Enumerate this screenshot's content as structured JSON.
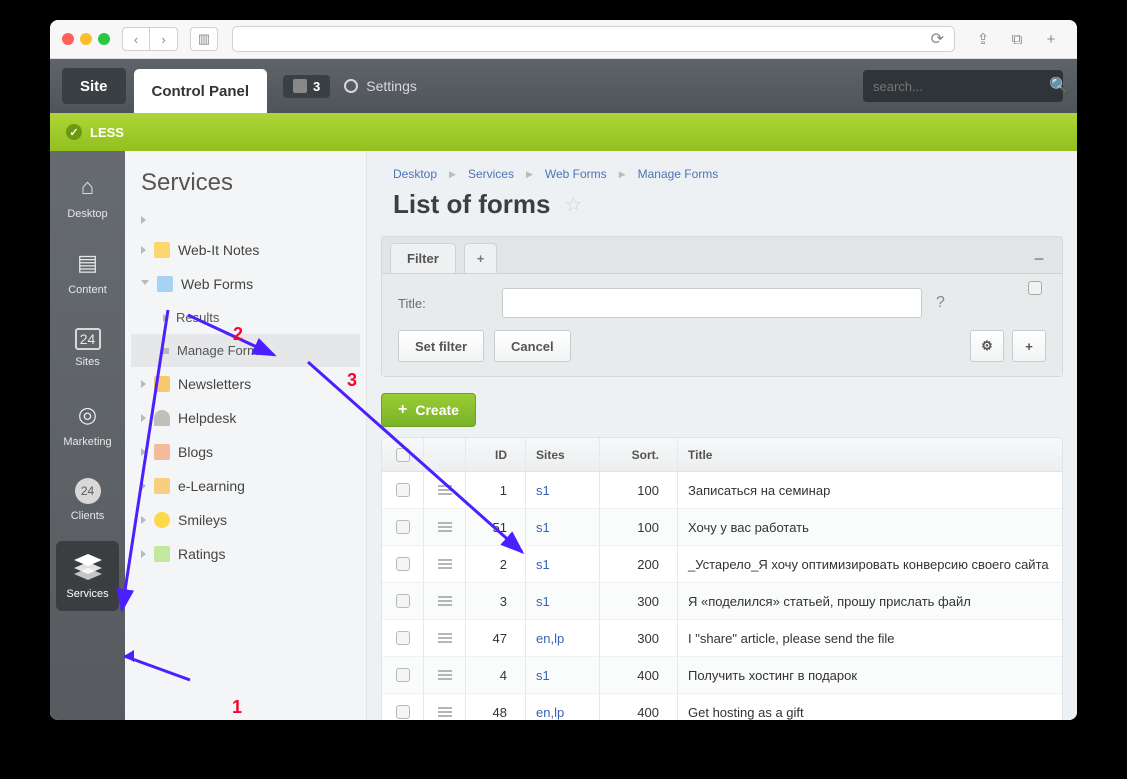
{
  "topbar": {
    "site_label": "Site",
    "cp_label": "Control Panel",
    "badge_count": "3",
    "settings_label": "Settings",
    "search_placeholder": "search..."
  },
  "greenbar": {
    "text": "LESS"
  },
  "rail": [
    {
      "label": "Desktop",
      "icon": "house-icon"
    },
    {
      "label": "Content",
      "icon": "doc-icon"
    },
    {
      "label": "Sites",
      "icon": "calendar-icon"
    },
    {
      "label": "Marketing",
      "icon": "target-icon"
    },
    {
      "label": "Clients",
      "icon": "client-icon"
    },
    {
      "label": "Services",
      "icon": "layers-icon",
      "active": true
    }
  ],
  "tree": {
    "title": "Services",
    "items": [
      {
        "icon": "ic-note",
        "label": "Web-It Notes"
      },
      {
        "icon": "ic-form",
        "label": "Web Forms",
        "open": true,
        "children": [
          {
            "label": "Results"
          },
          {
            "label": "Manage Forms",
            "selected": true
          }
        ]
      },
      {
        "icon": "ic-news",
        "label": "Newsletters"
      },
      {
        "icon": "ic-head",
        "label": "Helpdesk"
      },
      {
        "icon": "ic-blog",
        "label": "Blogs"
      },
      {
        "icon": "ic-learn",
        "label": "e-Learning"
      },
      {
        "icon": "ic-smile",
        "label": "Smileys"
      },
      {
        "icon": "ic-rate",
        "label": "Ratings"
      }
    ]
  },
  "breadcrumbs": [
    "Desktop",
    "Services",
    "Web Forms",
    "Manage Forms"
  ],
  "page_title": "List of forms",
  "filter": {
    "tab_label": "Filter",
    "title_label": "Title:",
    "set_filter": "Set filter",
    "cancel": "Cancel"
  },
  "create_label": "Create",
  "table": {
    "headers": {
      "id": "ID",
      "sites": "Sites",
      "sort": "Sort.",
      "title": "Title"
    },
    "rows": [
      {
        "id": "1",
        "sites": "s1",
        "sort": "100",
        "title": "Записаться на семинар"
      },
      {
        "id": "51",
        "sites": "s1",
        "sort": "100",
        "title": "Хочу у вас работать"
      },
      {
        "id": "2",
        "sites": "s1",
        "sort": "200",
        "title": "_Устарело_Я хочу оптимизировать конверсию своего сайта"
      },
      {
        "id": "3",
        "sites": "s1",
        "sort": "300",
        "title": "Я «поделился» статьей, прошу прислать файл"
      },
      {
        "id": "47",
        "sites": "en,lp",
        "sort": "300",
        "title": "I \"share\" article, please send the file"
      },
      {
        "id": "4",
        "sites": "s1",
        "sort": "400",
        "title": "Получить хостинг в подарок"
      },
      {
        "id": "48",
        "sites": "en,lp",
        "sort": "400",
        "title": "Get hosting as a gift"
      }
    ]
  },
  "annotations": {
    "n1": "1",
    "n2": "2",
    "n3": "3"
  }
}
